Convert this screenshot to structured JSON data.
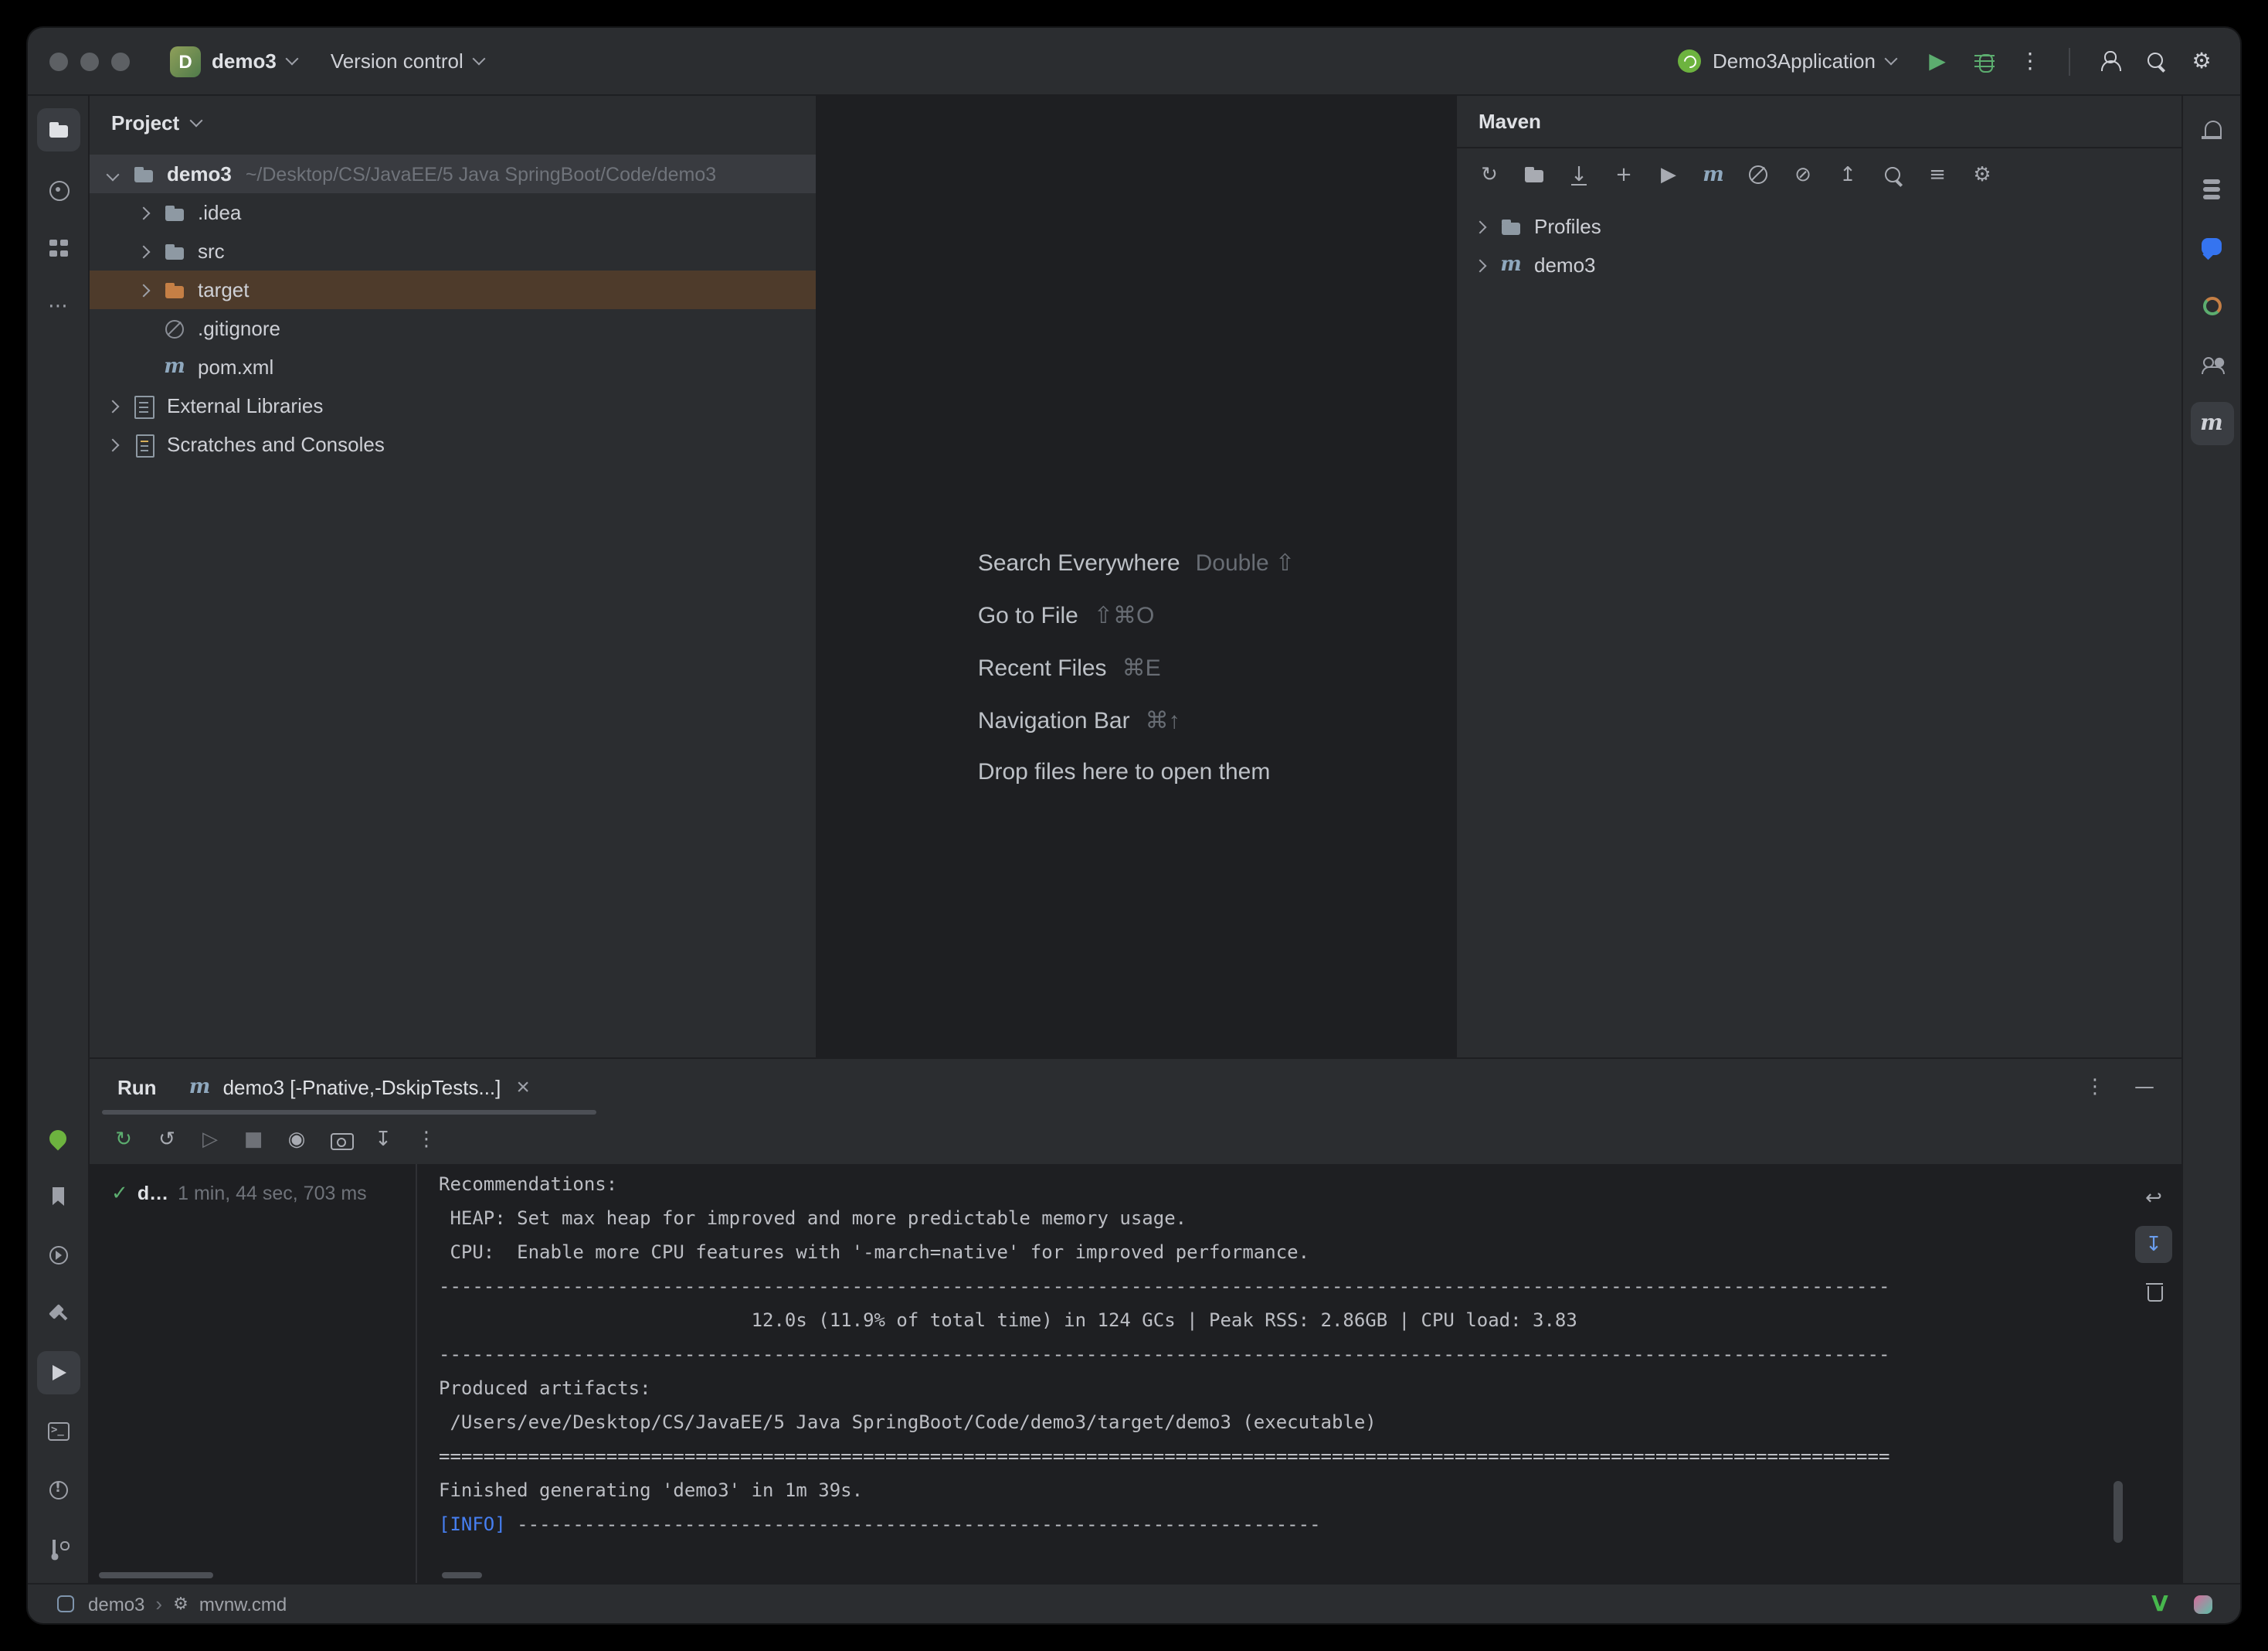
{
  "colors": {
    "accent_green": "#5CAD6F",
    "console_info_blue": "#467FF2",
    "selection_brown": "#4E3B2B",
    "hover_gray": "#393B40",
    "excluded_folder_orange": "#C57F45",
    "ai_blue": "#3574F0",
    "spring_green": "#6DB33F"
  },
  "titlebar": {
    "traffic_lights": [
      "close",
      "minimize",
      "zoom"
    ],
    "project_badge": "D",
    "project_name": "demo3",
    "vcs_widget_label": "Version control",
    "run_config_name": "Demo3Application",
    "right_icons": [
      {
        "name": "run-button",
        "glyph": "▶",
        "color": "#5CAD6F"
      },
      {
        "name": "debug-button",
        "color": "#5CAD6F"
      },
      {
        "name": "more-actions-icon",
        "glyph": "⋮"
      },
      {
        "name": "divider"
      },
      {
        "name": "add-user-icon"
      },
      {
        "name": "search-icon"
      },
      {
        "name": "settings-gear-icon",
        "glyph": "⚙"
      }
    ]
  },
  "left_rail": {
    "top": [
      {
        "name": "project-tool-icon",
        "active": true
      },
      {
        "name": "commit-tool-icon"
      },
      {
        "name": "structure-tool-icon"
      },
      {
        "name": "more-tool-windows-icon",
        "glyph": "⋯"
      }
    ],
    "bottom": [
      {
        "name": "spring-tool-icon",
        "color": "#6DB33F"
      },
      {
        "name": "bookmarks-tool-icon"
      },
      {
        "name": "services-tool-icon"
      },
      {
        "name": "build-tool-icon"
      },
      {
        "name": "run-tool-icon",
        "active": true
      },
      {
        "name": "terminal-tool-icon"
      },
      {
        "name": "problems-tool-icon"
      },
      {
        "name": "git-tool-icon"
      }
    ]
  },
  "right_rail": {
    "items": [
      {
        "name": "notifications-icon"
      },
      {
        "name": "database-tool-icon"
      },
      {
        "name": "ai-assistant-tool-icon",
        "color": "#3574F0"
      },
      {
        "name": "profiler-tool-icon"
      },
      {
        "name": "code-with-me-icon"
      },
      {
        "name": "maven-tool-icon",
        "glyph": "m",
        "active": true,
        "color": "#CED0D6"
      }
    ]
  },
  "project_panel": {
    "title": "Project",
    "tree": [
      {
        "level": 0,
        "chevron": "down",
        "icon": "project-folder",
        "label": "demo3",
        "bold": true,
        "extra": "~/Desktop/CS/JavaEE/5 Java SpringBoot/Code/demo3",
        "row": "hover"
      },
      {
        "level": 1,
        "chevron": "right",
        "icon": "folder",
        "label": ".idea"
      },
      {
        "level": 1,
        "chevron": "right",
        "icon": "folder",
        "label": "src"
      },
      {
        "level": 1,
        "chevron": "right",
        "icon": "folder-excluded",
        "label": "target",
        "row": "selected"
      },
      {
        "level": 1,
        "chevron": "none",
        "icon": "ignored-file",
        "label": ".gitignore"
      },
      {
        "level": 1,
        "chevron": "none",
        "icon": "maven-file",
        "icon_glyph": "m",
        "label": "pom.xml"
      },
      {
        "level": 0,
        "chevron": "right",
        "icon": "libraries",
        "label": "External Libraries"
      },
      {
        "level": 0,
        "chevron": "right",
        "icon": "scratches",
        "label": "Scratches and Consoles"
      }
    ]
  },
  "editor": {
    "shortcuts": [
      {
        "label": "Search Everywhere",
        "keys": "Double ⇧"
      },
      {
        "label": "Go to File",
        "keys": "⇧⌘O"
      },
      {
        "label": "Recent Files",
        "keys": "⌘E"
      },
      {
        "label": "Navigation Bar",
        "keys": "⌘↑"
      },
      {
        "label": "Drop files here to open them",
        "keys": ""
      }
    ]
  },
  "maven_panel": {
    "title": "Maven",
    "toolbar": [
      {
        "name": "refresh-maven-icon",
        "glyph": "↻"
      },
      {
        "name": "generate-sources-icon"
      },
      {
        "name": "download-sources-icon",
        "glyph": "↓"
      },
      {
        "name": "add-maven-project-icon",
        "glyph": "+"
      },
      {
        "name": "run-maven-build-icon",
        "glyph": "▶"
      },
      {
        "name": "execute-goal-icon",
        "glyph": "m"
      },
      {
        "name": "offline-mode-icon"
      },
      {
        "name": "skip-tests-icon",
        "glyph": "⊘"
      },
      {
        "name": "collapse-all-icon",
        "glyph": "↥"
      },
      {
        "name": "search-maven-icon"
      },
      {
        "name": "filter-icon",
        "glyph": "≡"
      },
      {
        "name": "maven-settings-icon",
        "glyph": "⚙"
      }
    ],
    "tree": [
      {
        "level": 0,
        "chevron": "right",
        "icon": "folder",
        "label": "Profiles"
      },
      {
        "level": 0,
        "chevron": "right",
        "icon": "maven",
        "icon_glyph": "m",
        "label": "demo3"
      }
    ]
  },
  "run_panel": {
    "title": "Run",
    "tab": {
      "icon_glyph": "m",
      "label": "demo3 [-Pnative,-DskipTests...]",
      "close_glyph": "×"
    },
    "window_icons": [
      {
        "name": "more-icon",
        "glyph": "⋮"
      },
      {
        "name": "minimize-icon",
        "glyph": "—"
      }
    ],
    "toolbar": [
      {
        "name": "rerun-icon",
        "glyph": "↻",
        "color": "#5CAD6F"
      },
      {
        "name": "rerun-failed-icon",
        "glyph": "↺"
      },
      {
        "name": "resume-icon",
        "glyph": "▷",
        "color": "#6E7177"
      },
      {
        "name": "stop-icon",
        "glyph": "■",
        "color": "#6E7177"
      },
      {
        "name": "eye-icon",
        "glyph": "◉"
      },
      {
        "name": "thread-dump-icon"
      },
      {
        "name": "export-icon",
        "glyph": "↧"
      },
      {
        "name": "more-run-options-icon",
        "glyph": "⋮"
      }
    ],
    "result": {
      "status_glyph": "✓",
      "label": "d…",
      "duration": "1 min, 44 sec, 703 ms"
    },
    "console": [
      {
        "text": "Recommendations:"
      },
      {
        "text": " HEAP: Set max heap for improved and more predictable memory usage."
      },
      {
        "text": " CPU:  Enable more CPU features with '-march=native' for improved performance."
      },
      {
        "text": "----------------------------------------------------------------------------------------------------------------------------------"
      },
      {
        "text": "                            12.0s (11.9% of total time) in 124 GCs | Peak RSS: 2.86GB | CPU load: 3.83"
      },
      {
        "text": "----------------------------------------------------------------------------------------------------------------------------------"
      },
      {
        "text": "Produced artifacts:"
      },
      {
        "text": " /Users/eve/Desktop/CS/JavaEE/5 Java SpringBoot/Code/demo3/target/demo3 (executable)"
      },
      {
        "text": "=================================================================================================================================="
      },
      {
        "text": "Finished generating 'demo3' in 1m 39s."
      },
      {
        "prefix": "[INFO]",
        "text": " ------------------------------------------------------------------------"
      }
    ],
    "console_toolbar": [
      {
        "name": "soft-wrap-icon",
        "glyph": "↩"
      },
      {
        "name": "scroll-to-end-icon",
        "glyph": "↧",
        "active": true,
        "color": "#6A9DED"
      },
      {
        "name": "clear-console-icon"
      }
    ]
  },
  "status_bar": {
    "breadcrumbs": [
      "demo3",
      "mvnw.cmd"
    ],
    "separator": "›",
    "right_icons": [
      {
        "name": "v-plugin-icon",
        "glyph": "V",
        "color": "#47B84D"
      },
      {
        "name": "assistant-plugin-icon"
      }
    ]
  }
}
